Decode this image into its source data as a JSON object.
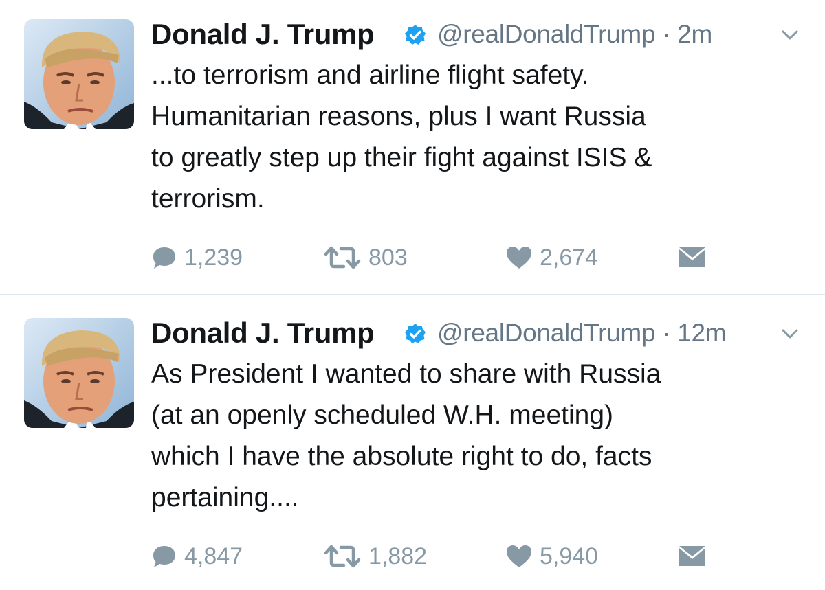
{
  "colors": {
    "text": "#14171a",
    "secondary": "#657786",
    "action_gray": "#8899a6",
    "verified_blue": "#1da1f2",
    "divider": "#e1e8ed"
  },
  "tweets": [
    {
      "name": "Donald J. Trump",
      "handle": "@realDonaldTrump",
      "time": "2m",
      "text": "...to terrorism and airline flight safety.\nHumanitarian reasons, plus I want Russia\nto greatly step up their fight against ISIS &\nterrorism.",
      "replies": "1,239",
      "retweets": "803",
      "likes": "2,674",
      "icons": [
        "reply-icon",
        "retweet-icon",
        "like-icon",
        "direct-message-icon",
        "verified-badge-icon",
        "chevron-down-icon"
      ]
    },
    {
      "name": "Donald J. Trump",
      "handle": "@realDonaldTrump",
      "time": "12m",
      "text": "As President I wanted to share with Russia\n(at an openly scheduled W.H. meeting)\nwhich I have the absolute right to do, facts\npertaining....",
      "replies": "4,847",
      "retweets": "1,882",
      "likes": "5,940",
      "icons": [
        "reply-icon",
        "retweet-icon",
        "like-icon",
        "direct-message-icon",
        "verified-badge-icon",
        "chevron-down-icon"
      ]
    }
  ]
}
